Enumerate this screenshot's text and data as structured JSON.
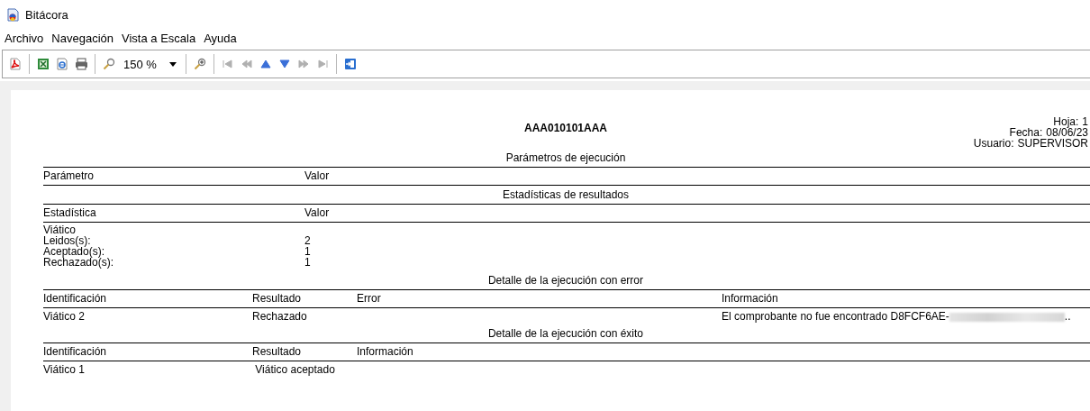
{
  "window": {
    "title": "Bitácora"
  },
  "menu": [
    "Archivo",
    "Navegación",
    "Vista a Escala",
    "Ayuda"
  ],
  "toolbar": {
    "zoom": "150 %",
    "nav": [
      {
        "disabled": true
      },
      {
        "disabled": true
      },
      {
        "disabled": false
      },
      {
        "disabled": false
      },
      {
        "disabled": true
      },
      {
        "disabled": true
      }
    ]
  },
  "report": {
    "title": "AAA010101AAA",
    "info": [
      {
        "label": "Hoja:",
        "value": "1"
      },
      {
        "label": "Fecha:",
        "value": "08/06/23"
      },
      {
        "label": "Usuario:",
        "value": "SUPERVISOR"
      }
    ],
    "sections": [
      {
        "kind": "params",
        "title": "Parámetros de ejecución",
        "columns": [
          "Parámetro",
          "Valor"
        ]
      },
      {
        "kind": "stats",
        "title": "Estadísticas de resultados",
        "columns": [
          "Estadística",
          "Valor"
        ],
        "rows": [
          {
            "cells": [
              "Viático"
            ]
          },
          {
            "cells": [
              "Leidos(s):",
              "2"
            ]
          },
          {
            "cells": [
              "Aceptado(s):",
              "1"
            ]
          },
          {
            "cells": [
              "Rechazado(s):",
              "1"
            ]
          }
        ]
      },
      {
        "kind": "errors",
        "title": "Detalle de la ejecución con error",
        "columns": [
          "Identificación",
          "Resultado",
          "Error",
          "Información"
        ],
        "rows": [
          {
            "cells": [
              "Viático 2",
              "Rechazado",
              "",
              {
                "text": "El comprobante no fue encontrado D8FCF6AE-",
                "redacted": true,
                "tail": ".."
              }
            ]
          }
        ]
      },
      {
        "kind": "success",
        "title": "Detalle de la ejecución con éxito",
        "columns": [
          "Identificación",
          "Resultado",
          "Información"
        ],
        "rows": [
          {
            "cells": [
              "Viático 1",
              " Viático aceptado"
            ]
          }
        ]
      }
    ]
  }
}
